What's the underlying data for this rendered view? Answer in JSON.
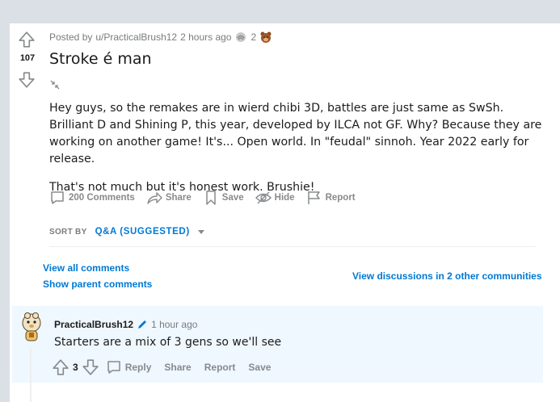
{
  "post": {
    "meta_prefix": "Posted by",
    "author": "u/PracticalBrush12",
    "time": "2 hours ago",
    "award_count": "2",
    "score": "107",
    "title": "Stroke é man",
    "body": [
      "Hey guys, so the remakes are in wierd chibi 3D, battles are just same as SwSh. Brilliant D and Shining P, this year, developed by ILCA not GF. Why? Because they are working on another game! It's... Open world. In \"feudal\" sinnoh. Year 2022 early for release.",
      "That's not much but it's honest work. Brushie!"
    ],
    "actions": {
      "comments": "200 Comments",
      "share": "Share",
      "save": "Save",
      "hide": "Hide",
      "report": "Report"
    }
  },
  "sort": {
    "label": "SORT BY",
    "value": "Q&A (SUGGESTED)"
  },
  "links": {
    "view_all": "View all comments",
    "show_parent": "Show parent comments",
    "other_communities": "View discussions in 2 other communities"
  },
  "comment": {
    "author": "PracticalBrush12",
    "time": "1 hour ago",
    "text": "Starters are a mix of 3 gens so we'll see",
    "score": "3",
    "actions": {
      "reply": "Reply",
      "share": "Share",
      "report": "Report",
      "save": "Save"
    }
  },
  "colors": {
    "background": "#dae0e6",
    "link": "#0079d3",
    "muted": "#878a8c",
    "comment_highlight": "#eff7ff"
  }
}
